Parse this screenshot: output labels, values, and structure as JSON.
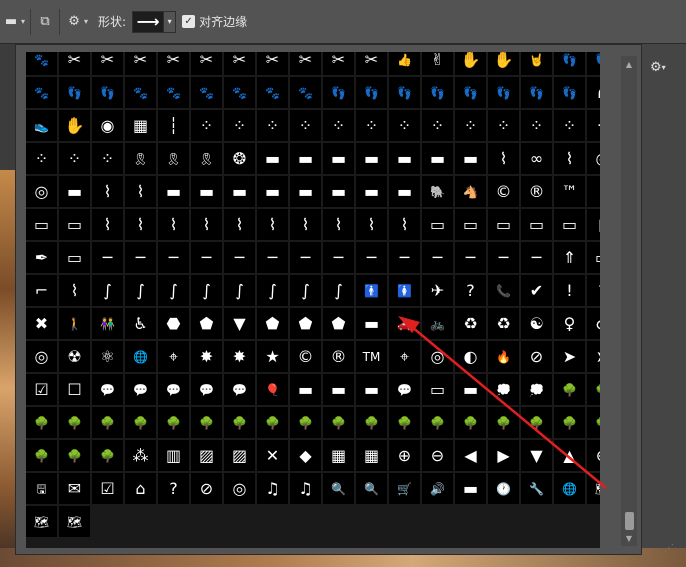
{
  "toolbar": {
    "shape_label": "形状:",
    "shape_preview_glyph": "⟶",
    "align_edges_label": "对齐边缘",
    "align_edges_checked": true,
    "icons": [
      "path-ops-icon",
      "path-arrange-icon",
      "gear-icon"
    ]
  },
  "panel": {
    "settings_icon": "gear-icon",
    "shapes": [
      "🐾",
      "✂",
      "✂",
      "✂",
      "✂",
      "✂",
      "✂",
      "✂",
      "✂",
      "✂",
      "✂",
      "👍",
      "✌",
      "✋",
      "✋",
      "🤘",
      "👣",
      "👣",
      "🐾",
      "👣",
      "👣",
      "🐾",
      "🐾",
      "🐾",
      "🐾",
      "🐾",
      "🐾",
      "👣",
      "👣",
      "👣",
      "👣",
      "👣",
      "👣",
      "👣",
      "👣",
      "∩",
      "👟",
      "✋",
      "◉",
      "▦",
      "┆",
      "⁘",
      "⁘",
      "⁘",
      "⁘",
      "⁘",
      "⁘",
      "⁘",
      "⁘",
      "⁘",
      "⁘",
      "⁘",
      "⁘",
      "⁘",
      "⁘",
      "⁘",
      "⁘",
      "🎗",
      "🎗",
      "🎗",
      "❂",
      "▬",
      "▬",
      "▬",
      "▬",
      "▬",
      "▬",
      "▬",
      "⌇",
      "∞",
      "⌇",
      "◎",
      "◎",
      "▬",
      "⌇",
      "⌇",
      "▬",
      "▬",
      "▬",
      "▬",
      "▬",
      "▬",
      "▬",
      "▬",
      "🐘",
      "🐴",
      "©",
      "®",
      "™",
      "⌇",
      "▭",
      "▭",
      "⌇",
      "⌇",
      "⌇",
      "⌇",
      "⌇",
      "⌇",
      "⌇",
      "⌇",
      "⌇",
      "⌇",
      "▭",
      "▭",
      "▭",
      "▭",
      "▭",
      "▯",
      "✒",
      "▭",
      "─",
      "─",
      "─",
      "─",
      "─",
      "─",
      "─",
      "─",
      "─",
      "─",
      "─",
      "─",
      "─",
      "─",
      "⇑",
      "▭",
      "⌐",
      "⌇",
      "∫",
      "∫",
      "∫",
      "∫",
      "∫",
      "∫",
      "∫",
      "∫",
      "🚹",
      "🚺",
      "✈",
      "?",
      "📞",
      "✔",
      "!",
      "?",
      "✖",
      "🚶",
      "👫",
      "♿",
      "⬣",
      "⬟",
      "▼",
      "⬟",
      "⬟",
      "⬟",
      "▬",
      "🚗",
      "🚲",
      "♻",
      "♻",
      "☯",
      "♀",
      "♂",
      "◎",
      "☢",
      "⚛",
      "🌐",
      "⌖",
      "✸",
      "✸",
      "★",
      "©",
      "®",
      "TM",
      "⌖",
      "◎",
      "◐",
      "🔥",
      "⊘",
      "➤",
      "➤",
      "☑",
      "☐",
      "💬",
      "💬",
      "💬",
      "💬",
      "💬",
      "🎈",
      "▬",
      "▬",
      "▬",
      "💬",
      "▭",
      "▬",
      "💭",
      "💭",
      "🌳",
      "🌳",
      "🌳",
      "🌳",
      "🌳",
      "🌳",
      "🌳",
      "🌳",
      "🌳",
      "🌳",
      "🌳",
      "🌳",
      "🌳",
      "🌳",
      "🌳",
      "🌳",
      "🌳",
      "🌳",
      "🌳",
      "🌳",
      "🌳",
      "🌳",
      "🌳",
      "⁂",
      "▥",
      "▨",
      "▨",
      "✕",
      "◆",
      "▦",
      "▦",
      "⊕",
      "⊖",
      "◀",
      "▶",
      "▼",
      "▲",
      "⊕",
      "🖫",
      "✉",
      "☑",
      "⌂",
      "?",
      "⊘",
      "◎",
      "♫",
      "♫",
      "🔍",
      "🔍",
      "🛒",
      "🔊",
      "▬",
      "🕐",
      "🔧",
      "🌐",
      "🗺",
      "🗺",
      "🗺"
    ]
  },
  "colors": {
    "toolbar_bg": "#535353",
    "panel_bg": "#535353",
    "cell_bg": "#000000",
    "annotation_arrow": "#e02020"
  }
}
